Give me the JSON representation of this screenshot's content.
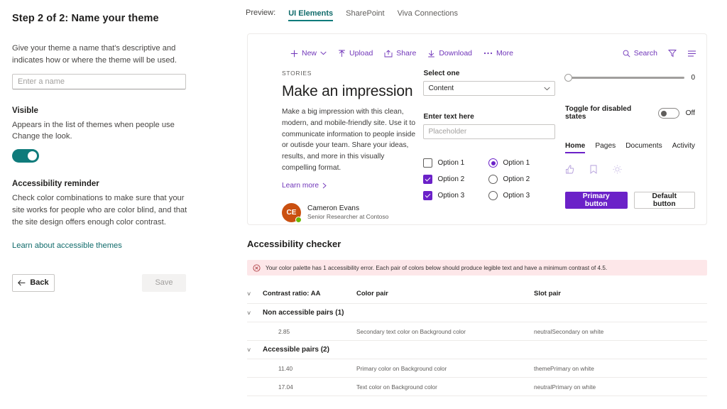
{
  "left_panel": {
    "step_title": "Step 2 of 2: Name your theme",
    "description": "Give your theme a name that's descriptive and indicates how or where the theme will be used.",
    "name_input_placeholder": "Enter a name",
    "name_input_value": "",
    "visible_heading": "Visible",
    "visible_description": "Appears in the list of themes when people use Change the look.",
    "visible_toggle_state": "on",
    "visible_toggle_color": "#0f7b7b",
    "accessibility_heading": "Accessibility reminder",
    "accessibility_description": "Check color combinations to make sure that your site works for people who are color blind, and that the site design offers enough color contrast.",
    "learn_link": "Learn about accessible themes",
    "back_label": "Back",
    "save_label": "Save",
    "save_disabled": true
  },
  "preview_tabs": {
    "label": "Preview:",
    "items": [
      {
        "label": "UI Elements",
        "active": true
      },
      {
        "label": "SharePoint",
        "active": false
      },
      {
        "label": "Viva Connections",
        "active": false
      }
    ],
    "accent_color": "#0f7b7b"
  },
  "command_bar": {
    "items": [
      {
        "label": "New",
        "icon": "plus-icon",
        "has_chevron": true
      },
      {
        "label": "Upload",
        "icon": "upload-icon",
        "has_chevron": false
      },
      {
        "label": "Share",
        "icon": "share-icon",
        "has_chevron": false
      },
      {
        "label": "Download",
        "icon": "download-icon",
        "has_chevron": false
      },
      {
        "label": "More",
        "icon": "ellipsis-icon",
        "has_chevron": false
      }
    ],
    "search_label": "Search",
    "filter_icon": "filter-icon",
    "list_icon": "list-icon",
    "color": "#7035b9"
  },
  "hero": {
    "eyebrow": "STORIES",
    "title": "Make an impression",
    "body": "Make a big impression with this clean, modern, and mobile-friendly site. Use it to communicate information to people inside or outisde your team. Share your ideas, results, and more in this visually compelling format.",
    "learn_more": "Learn more",
    "persona": {
      "initials": "CE",
      "name": "Cameron Evans",
      "role": "Senior Researcher at Contoso",
      "avatar_color": "#ca5010",
      "presence_color": "#6bb700"
    }
  },
  "form": {
    "select_label": "Select one",
    "select_value": "Content",
    "text_label": "Enter text here",
    "text_placeholder": "Placeholder",
    "text_value": "",
    "checkboxes": [
      {
        "label": "Option 1",
        "checked": false
      },
      {
        "label": "Option 2",
        "checked": true
      },
      {
        "label": "Option 3",
        "checked": true
      }
    ],
    "radios": [
      {
        "label": "Option 1",
        "selected": true
      },
      {
        "label": "Option 2",
        "selected": false
      },
      {
        "label": "Option 3",
        "selected": false
      }
    ],
    "accent_color": "#6b21c8"
  },
  "controls": {
    "slider_value": "0",
    "toggle_label": "Toggle for disabled states",
    "toggle_state": "Off",
    "nav_items": [
      {
        "label": "Home",
        "active": true
      },
      {
        "label": "Pages",
        "active": false
      },
      {
        "label": "Documents",
        "active": false
      },
      {
        "label": "Activity",
        "active": false
      }
    ],
    "disabled_icons": [
      "like-icon",
      "bookmark-icon",
      "brightness-icon"
    ],
    "primary_button": "Primary button",
    "default_button": "Default button"
  },
  "accessibility_checker": {
    "title": "Accessibility checker",
    "error_icon": "error-circle-icon",
    "error_message": "Your color palette has 1 accessibility error. Each pair of colors below should produce legible text and have a minimum contrast of 4.5.",
    "columns": [
      "Contrast ratio: AA",
      "Color pair",
      "Slot pair"
    ],
    "groups": [
      {
        "title": "Non accessible pairs (1)",
        "rows": [
          {
            "ratio": "2.85",
            "color_pair": "Secondary text color on Background color",
            "slot_pair": "neutralSecondary on white"
          }
        ]
      },
      {
        "title": "Accessible pairs (2)",
        "rows": [
          {
            "ratio": "11.40",
            "color_pair": "Primary color on Background color",
            "slot_pair": "themePrimary on white"
          },
          {
            "ratio": "17.04",
            "color_pair": "Text color on Background color",
            "slot_pair": "neutralPrimary on white"
          }
        ]
      }
    ]
  }
}
